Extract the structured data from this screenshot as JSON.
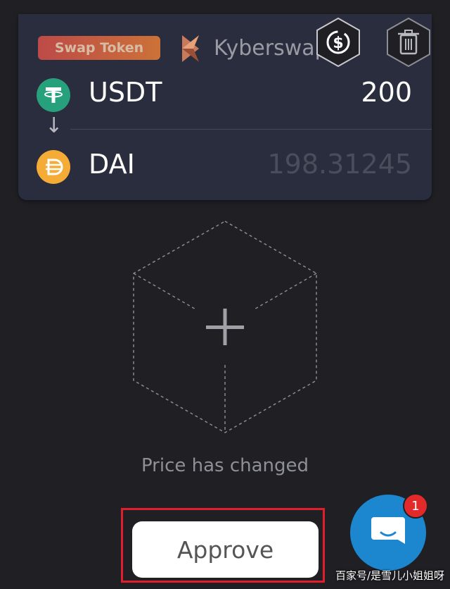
{
  "swap_card": {
    "badge_label": "Swap Token",
    "provider_name": "Kyberswap",
    "from_token": {
      "symbol": "USDT",
      "amount": "200",
      "icon": "tether-icon",
      "color": "#26a17b"
    },
    "to_token": {
      "symbol": "DAI",
      "amount": "198.31245",
      "icon": "dai-icon",
      "color": "#f5ac37"
    },
    "arrow": "↓"
  },
  "toolbar": {
    "actions": [
      {
        "name": "swap-dollar-icon"
      },
      {
        "name": "trash-icon"
      }
    ]
  },
  "canvas": {
    "add_icon": "plus-icon",
    "status_text": "Price has changed"
  },
  "approve": {
    "label": "Approve"
  },
  "chat": {
    "icon": "chat-icon",
    "badge_count": "1"
  },
  "watermark": {
    "text": "百家号/是雪儿小姐姐呀"
  },
  "colors": {
    "background": "#1f1f24",
    "card": "#2a2d3d",
    "highlight_border": "#e21e2c",
    "chat_blue": "#1c86cf",
    "badge_red": "#e22a2a"
  }
}
